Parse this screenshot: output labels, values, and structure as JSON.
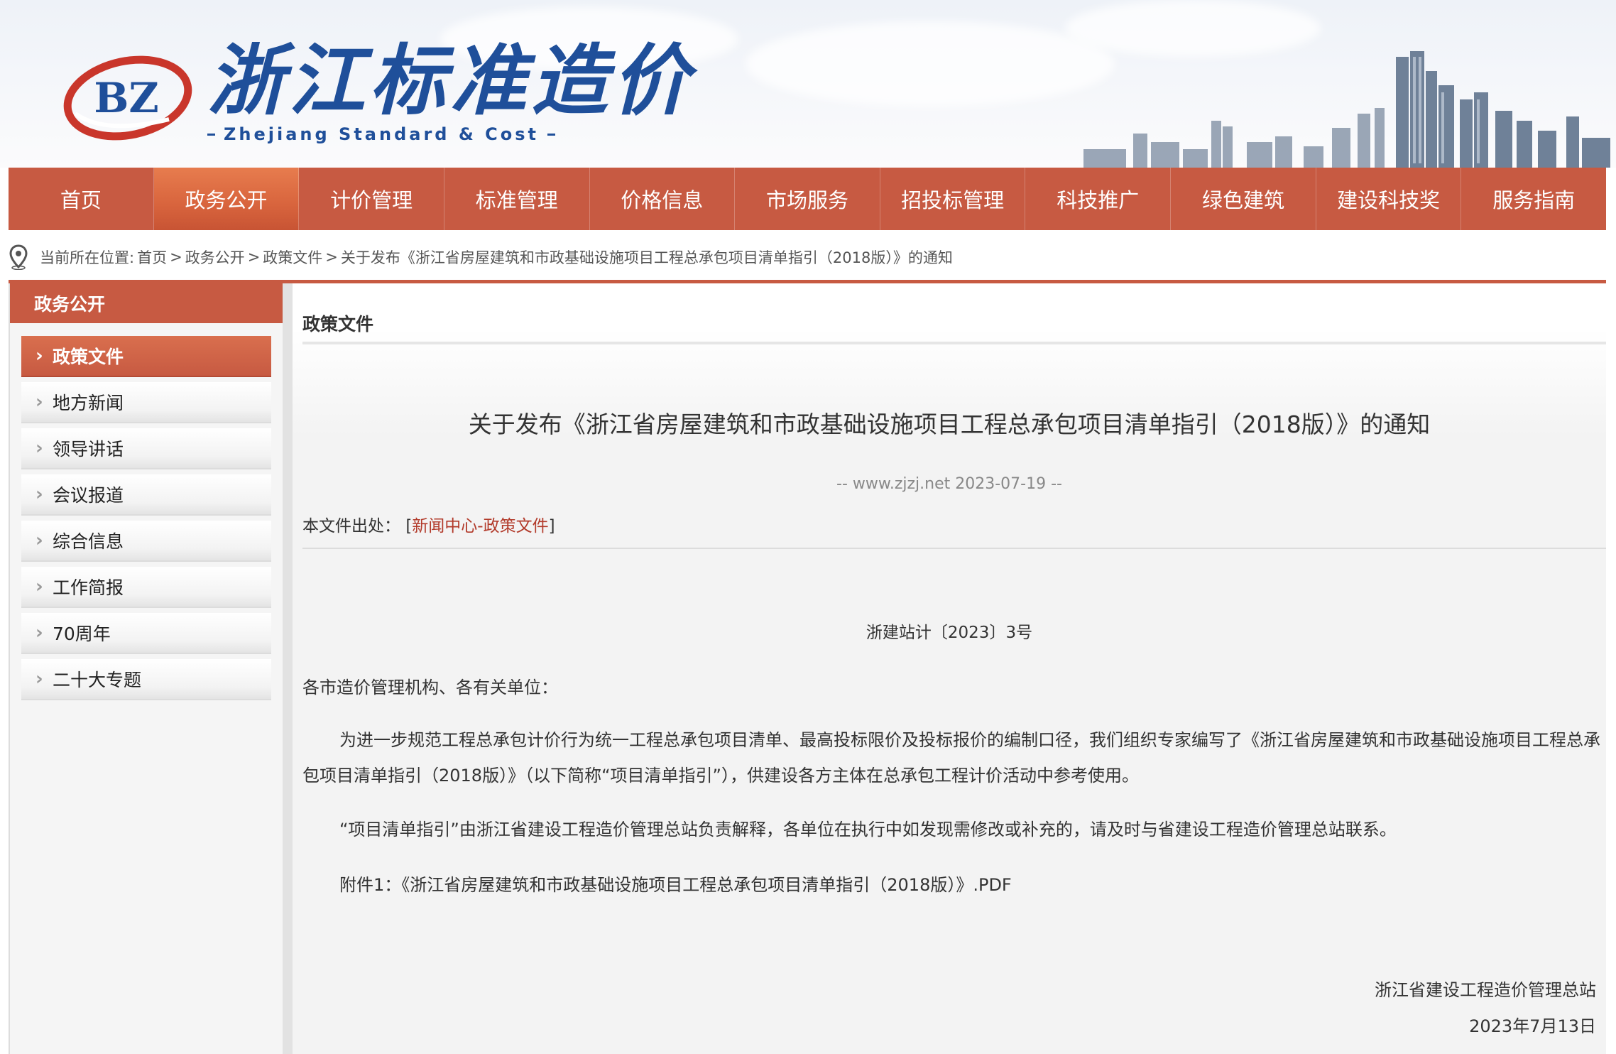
{
  "header": {
    "logo_mark": "BZ",
    "logo_title": "浙江标准造价",
    "logo_subtitle": "Zhejiang Standard & Cost"
  },
  "nav": {
    "items": [
      {
        "label": "首页"
      },
      {
        "label": "政务公开"
      },
      {
        "label": "计价管理"
      },
      {
        "label": "标准管理"
      },
      {
        "label": "价格信息"
      },
      {
        "label": "市场服务"
      },
      {
        "label": "招投标管理"
      },
      {
        "label": "科技推广"
      },
      {
        "label": "绿色建筑"
      },
      {
        "label": "建设科技奖"
      },
      {
        "label": "服务指南"
      }
    ],
    "active_index": 1
  },
  "breadcrumb": {
    "prefix": "当前所在位置:",
    "home": "首页",
    "sep1": ">",
    "level1": "政务公开",
    "sep2": ">",
    "level2": "政策文件",
    "sep3": ">",
    "current": "关于发布《浙江省房屋建筑和市政基础设施项目工程总承包项目清单指引（2018版）》的通知"
  },
  "sidebar": {
    "title": "政务公开",
    "items": [
      {
        "label": "政策文件"
      },
      {
        "label": "地方新闻"
      },
      {
        "label": "领导讲话"
      },
      {
        "label": "会议报道"
      },
      {
        "label": "综合信息"
      },
      {
        "label": "工作简报"
      },
      {
        "label": "70周年"
      },
      {
        "label": "二十大专题"
      }
    ],
    "chevron": "›"
  },
  "content": {
    "category": "政策文件",
    "title": "关于发布《浙江省房屋建筑和市政基础设施项目工程总承包项目清单指引（2018版）》的通知",
    "meta": "-- www.zjzj.net 2023-07-19 --",
    "source_label": "本文件出处：",
    "source_open": "[",
    "source_link": "新闻中心-政策文件",
    "source_close": "]",
    "doc_number": "浙建站计〔2023〕3号",
    "salutation": "各市造价管理机构、各有关单位：",
    "paragraph1": "为进一步规范工程总承包计价行为统一工程总承包项目清单、最高投标限价及投标报价的编制口径，我们组织专家编写了《浙江省房屋建筑和市政基础设施项目工程总承包项目清单指引（2018版）》（以下简称“项目清单指引”），供建设各方主体在总承包工程计价活动中参考使用。",
    "paragraph2": "“项目清单指引”由浙江省建设工程造价管理总站负责解释，各单位在执行中如发现需修改或补充的，请及时与省建设工程造价管理总站联系。",
    "attachment": "附件1：《浙江省房屋建筑和市政基础设施项目工程总承包项目清单指引（2018版）》.PDF",
    "signature": "浙江省建设工程造价管理总站",
    "date": "2023年7月13日"
  },
  "colors": {
    "brand_red": "#c75a42",
    "logo_blue": "#1f4f9a",
    "link_red": "#b23a2a"
  }
}
